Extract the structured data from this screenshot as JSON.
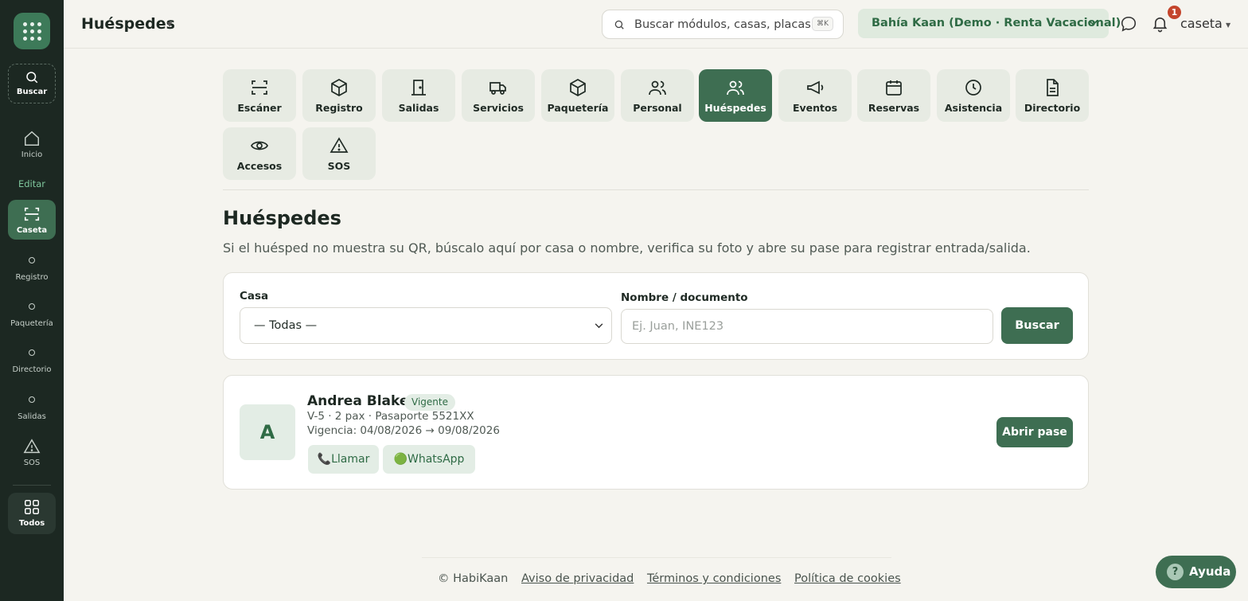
{
  "sidebar": {
    "search_label": "Buscar",
    "inicio_label": "Inicio",
    "editar_label": "Editar",
    "caseta_label": "Caseta",
    "registro_label": "Registro",
    "paqueteria_label": "Paquetería",
    "directorio_label": "Directorio",
    "salidas_label": "Salidas",
    "sos_label": "SOS",
    "todos_label": "Todos"
  },
  "header": {
    "title": "Huéspedes",
    "search_placeholder": "Buscar módulos, casas, placas...",
    "search_shortcut": "⌘K",
    "property": "Bahía Kaan (Demo · Renta Vacacional)",
    "notification_count": "1",
    "user": "caseta"
  },
  "modules": [
    {
      "label": "Escáner",
      "icon": "scan-icon"
    },
    {
      "label": "Registro",
      "icon": "box-icon"
    },
    {
      "label": "Salidas",
      "icon": "door-icon"
    },
    {
      "label": "Servicios",
      "icon": "truck-icon"
    },
    {
      "label": "Paquetería",
      "icon": "package-icon"
    },
    {
      "label": "Personal",
      "icon": "users-icon"
    },
    {
      "label": "Huéspedes",
      "icon": "guests-icon",
      "active": true
    },
    {
      "label": "Eventos",
      "icon": "megaphone-icon"
    },
    {
      "label": "Reservas",
      "icon": "calendar-icon"
    },
    {
      "label": "Asistencia",
      "icon": "clock-icon"
    },
    {
      "label": "Directorio",
      "icon": "document-icon"
    },
    {
      "label": "Accesos",
      "icon": "eye-icon"
    },
    {
      "label": "SOS",
      "icon": "warning-icon"
    }
  ],
  "main": {
    "title": "Huéspedes",
    "description": "Si el huésped no muestra su QR, búscalo aquí por casa o nombre, verifica su foto y abre su pase para registrar entrada/salida."
  },
  "search_form": {
    "casa_label": "Casa",
    "casa_value": "— Todas —",
    "nombre_label": "Nombre / documento",
    "nombre_placeholder": "Ej. Juan, INE123",
    "submit_label": "Buscar"
  },
  "guests": [
    {
      "initial": "A",
      "name": "Andrea Blake",
      "status": "Vigente",
      "meta": "V-5 · 2 pax · Pasaporte 5521XX",
      "validity": "Vigencia: 04/08/2026 → 09/08/2026",
      "call_label": "📞Llamar",
      "whatsapp_label": "🟢WhatsApp",
      "open_label": "Abrir pase"
    }
  ],
  "footer": {
    "copyright": "© HabiKaan",
    "privacy": "Aviso de privacidad",
    "terms": "Términos y condiciones",
    "cookies": "Política de cookies"
  },
  "help": {
    "label": "Ayuda",
    "glyph": "?"
  },
  "colors": {
    "brand": "#3e6e52",
    "sidebar": "#1c2822",
    "accent": "#7fc79d",
    "badge": "#c4452c"
  }
}
